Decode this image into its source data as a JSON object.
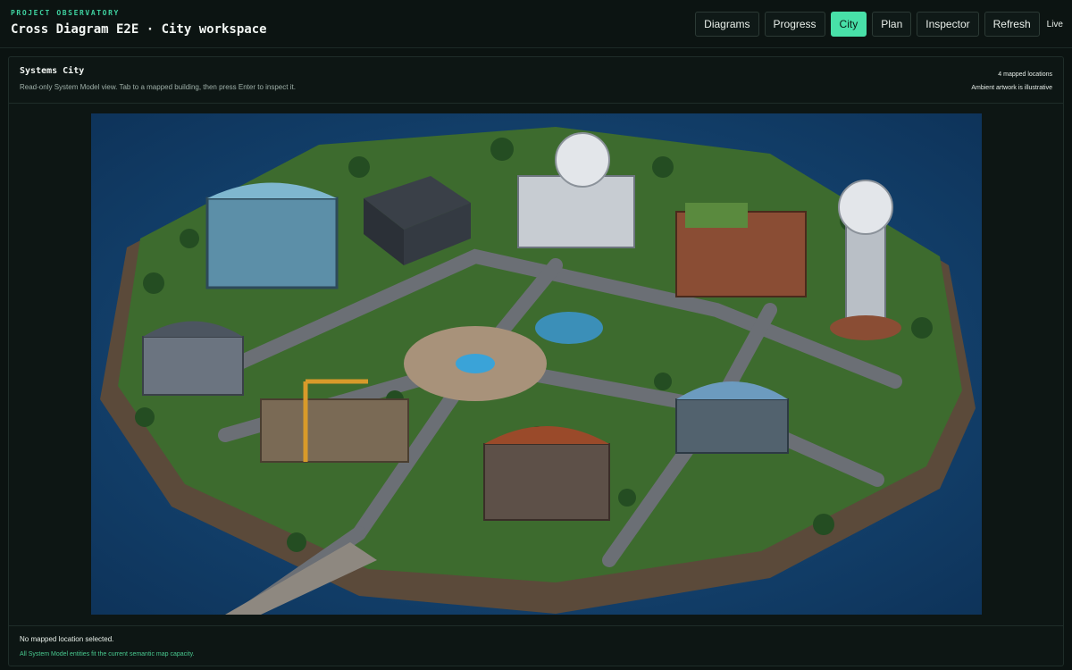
{
  "header": {
    "eyebrow": "PROJECT OBSERVATORY",
    "title": "Cross Diagram E2E · City workspace",
    "nav": [
      "Diagrams",
      "Progress",
      "City",
      "Plan",
      "Inspector",
      "Refresh"
    ],
    "active_nav": "City",
    "live_label": "Live"
  },
  "panel": {
    "title": "Systems City",
    "subtitle": "Read-only System Model view. Tab to a mapped building, then press Enter to inspect it.",
    "mapped_count": "4 mapped locations",
    "artwork_note": "Ambient artwork is illustrative"
  },
  "footer": {
    "selection_status": "No mapped location selected.",
    "capacity_note": "All System Model entities fit the current semantic map capacity."
  },
  "colors": {
    "accent": "#48e0a8",
    "background": "#0b1311",
    "water": "#123b66",
    "capacity_green": "#49c98f"
  }
}
